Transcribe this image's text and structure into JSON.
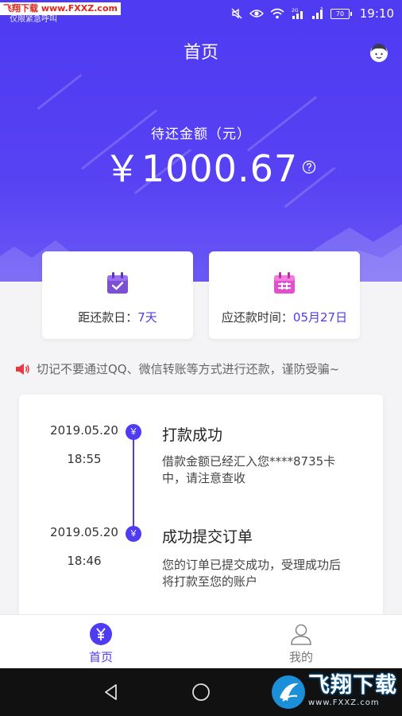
{
  "status_bar": {
    "watermark_text": "飞翔下载 www.FXXZ.com",
    "carrier_text": "仅限紧急呼叫",
    "battery_level": "70",
    "time": "19:10",
    "network_label": "2G"
  },
  "header": {
    "title": "首页",
    "avatar_icon": "avatar-icon"
  },
  "balance": {
    "label": "待还金额（元）",
    "amount": "￥1000.67",
    "help_icon": "question-icon"
  },
  "cards": [
    {
      "icon": "calendar-check-icon",
      "label": "距还款日：",
      "value": "7天",
      "icon_color": "#7b4fd6"
    },
    {
      "icon": "calendar-grid-icon",
      "label": "应还款时间：",
      "value": "05月27日",
      "icon_color": "#e34fcf"
    }
  ],
  "notice": {
    "icon": "speaker-icon",
    "text": "切记不要通过QQ、微信转账等方式进行还款，谨防受骗~"
  },
  "timeline": [
    {
      "date": "2019.05.20",
      "time": "18:55",
      "dot_label": "￥",
      "title": "打款成功",
      "description": "借款金额已经汇入您****8735卡中，请注意查收"
    },
    {
      "date": "2019.05.20",
      "time": "18:46",
      "dot_label": "￥",
      "title": "成功提交订单",
      "description": "您的订单已提交成功，受理成功后将打款至您的账户"
    }
  ],
  "bottom_nav": [
    {
      "label": "首页",
      "icon": "yuan-home-icon",
      "active": true
    },
    {
      "label": "我的",
      "icon": "person-icon",
      "active": false
    }
  ],
  "watermark_logo": {
    "text": "飞翔下载",
    "url": "www.FXXZ.com"
  },
  "colors": {
    "accent": "#4f3bf2",
    "background": "#f4f4f6",
    "calendar_purple": "#7b4fd6",
    "calendar_pink": "#e34fcf"
  }
}
